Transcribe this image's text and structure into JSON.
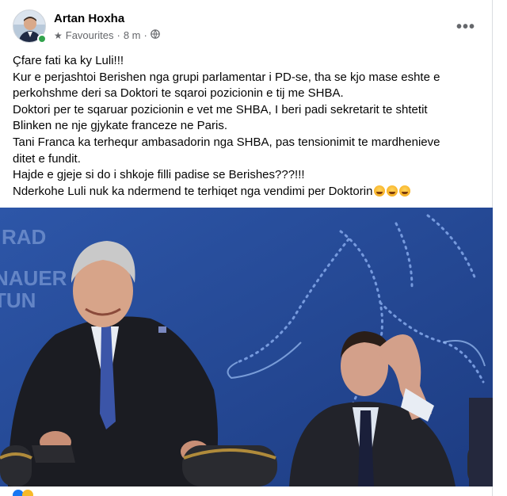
{
  "post": {
    "author": "Artan Hoxha",
    "audience": "Favourites",
    "time": "8 m",
    "text_lines": [
      "Çfare fati ka ky Luli!!!",
      "Kur e perjashtoi Berishen nga grupi parlamentar i PD-se, tha se kjo mase eshte e",
      "perkohshme deri sa Doktori te sqaroi pozicionin e tij me SHBA.",
      "Doktori per te sqaruar pozicionin e vet me SHBA, I beri padi sekretarit te shtetit",
      "Blinken ne nje gjykate franceze ne Paris.",
      "Tani Franca ka terhequr ambasadorin nga SHBA, pas tensionimit te mardhenieve",
      "ditet e fundit.",
      "Hajde e gjeje si do i shkoje filli padise se Berishes???!!!",
      "Nderkohe Luli nuk ka ndermend te terhiqet nga vendimi per Doktorin"
    ]
  },
  "photo": {
    "backdrop_text_lines": [
      "RAD",
      "NAUER",
      "TUN"
    ]
  },
  "colors": {
    "backdrop_blue": "#24489a",
    "text_secondary": "#65676b",
    "online_green": "#31a24c"
  },
  "icons": [
    "star-icon",
    "globe-icon",
    "more-options-icon",
    "laughing-emoji-icon"
  ]
}
